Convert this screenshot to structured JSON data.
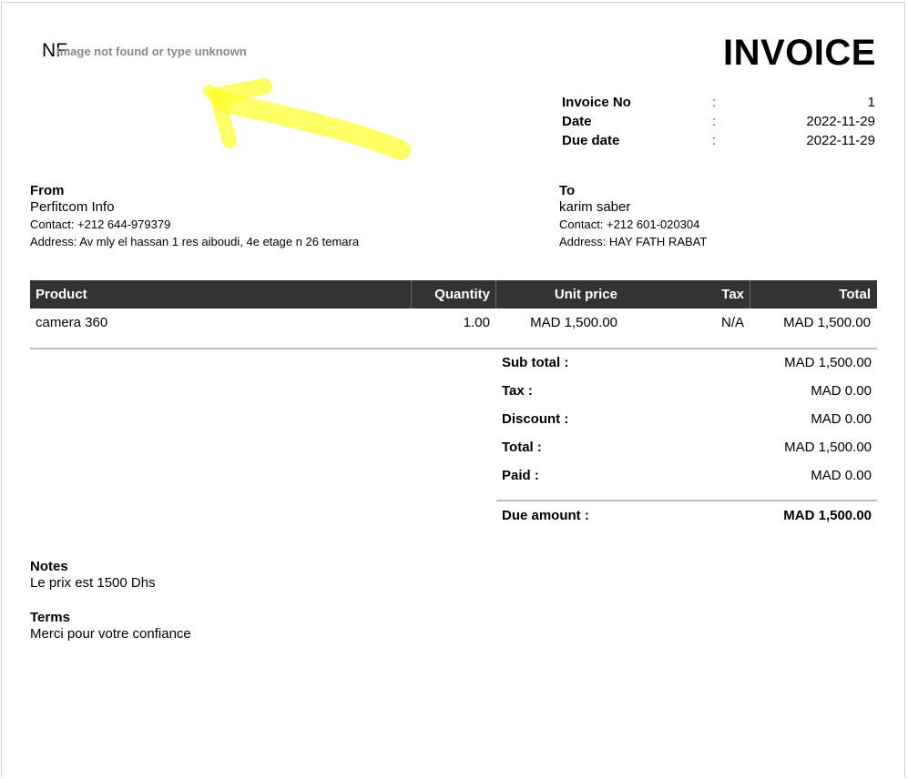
{
  "logo": {
    "broken_image_code": "NF",
    "broken_image_text": "Image not found or type unknown"
  },
  "title": "INVOICE",
  "meta": [
    {
      "label": "Invoice No",
      "sep": ":",
      "value": "1"
    },
    {
      "label": "Date",
      "sep": ":",
      "value": "2022-11-29"
    },
    {
      "label": "Due date",
      "sep": ":",
      "value": "2022-11-29"
    }
  ],
  "from": {
    "heading": "From",
    "name": "Perfitcom Info",
    "contact": "Contact: +212 644-979379",
    "address": "Address: Av mly el hassan 1 res aiboudi, 4e etage n 26 temara"
  },
  "to": {
    "heading": "To",
    "name": "karim saber",
    "contact": "Contact: +212 601-020304",
    "address": "Address: HAY FATH RABAT"
  },
  "table": {
    "headers": [
      "Product",
      "Quantity",
      "Unit price",
      "Tax",
      "Total"
    ],
    "rows": [
      [
        "camera 360",
        "1.00",
        "MAD 1,500.00",
        "N/A",
        "MAD 1,500.00"
      ]
    ]
  },
  "summary": [
    {
      "label": "Sub total :",
      "value": "MAD 1,500.00"
    },
    {
      "label": "Tax :",
      "value": "MAD 0.00"
    },
    {
      "label": "Discount :",
      "value": "MAD 0.00"
    },
    {
      "label": "Total :",
      "value": "MAD 1,500.00"
    },
    {
      "label": "Paid :",
      "value": "MAD 0.00"
    }
  ],
  "due": {
    "label": "Due amount :",
    "value": "MAD 1,500.00"
  },
  "notes": {
    "heading": "Notes",
    "text": "Le prix est 1500 Dhs"
  },
  "terms": {
    "heading": "Terms",
    "text": "Merci pour votre confiance"
  },
  "colors": {
    "table_header_bg": "#333333",
    "highlight": "#ffff33"
  }
}
